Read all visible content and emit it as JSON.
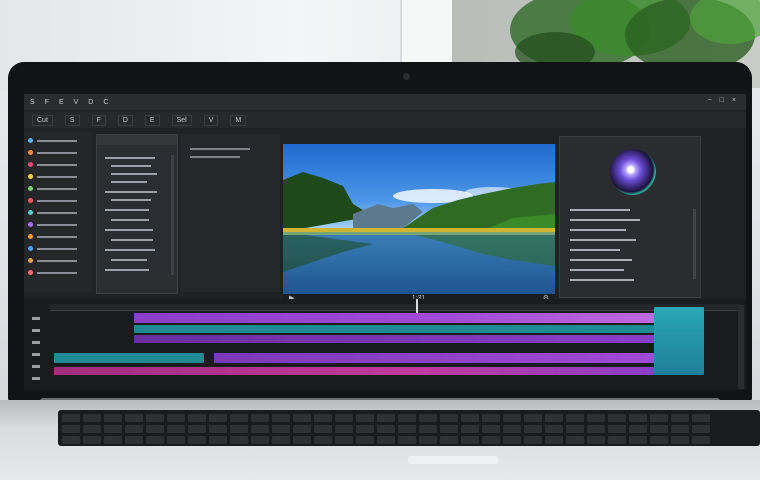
{
  "scene": {
    "description_free": true,
    "colors": {
      "accent_purple": "#a24bd6",
      "accent_teal": "#1f8a93",
      "accent_magenta": "#c03a9c"
    }
  },
  "editor": {
    "menubar": {
      "items": [
        "S",
        "F",
        "E",
        "V",
        "D",
        "C"
      ],
      "window_controls": [
        "−",
        "□",
        "×"
      ]
    },
    "toolbar": {
      "buttons": [
        "Cut",
        "S",
        "F",
        "D",
        "E",
        "Sel",
        "V",
        "M"
      ]
    },
    "viewer": {
      "timecode": "1:31"
    }
  }
}
